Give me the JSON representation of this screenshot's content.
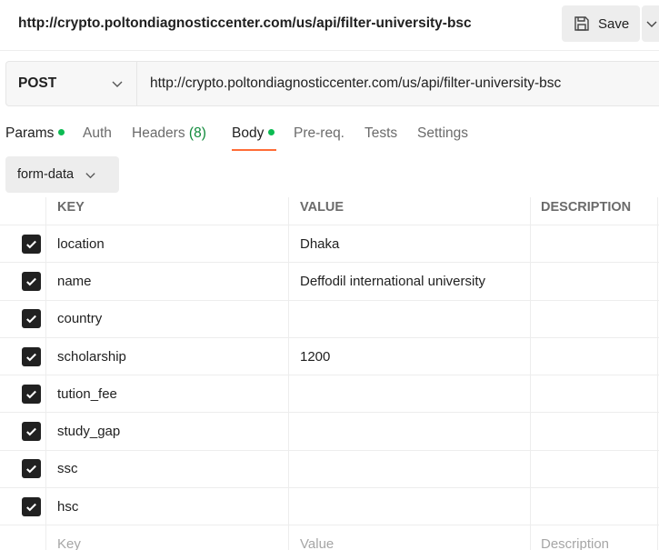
{
  "header": {
    "title": "http://crypto.poltondiagnosticcenter.com/us/api/filter-university-bsc",
    "save_label": "Save"
  },
  "request": {
    "method": "POST",
    "url": "http://crypto.poltondiagnosticcenter.com/us/api/filter-university-bsc"
  },
  "tabs": {
    "params": "Params",
    "auth": "Auth",
    "headers": "Headers",
    "headers_count": "(8)",
    "body": "Body",
    "prereq": "Pre-req.",
    "tests": "Tests",
    "settings": "Settings"
  },
  "body_type": "form-data",
  "table": {
    "columns": {
      "key": "KEY",
      "value": "VALUE",
      "description": "DESCRIPTION"
    },
    "rows": [
      {
        "key": "location",
        "value": "Dhaka",
        "description": "",
        "checked": true
      },
      {
        "key": "name",
        "value": "Deffodil international university",
        "description": "",
        "checked": true
      },
      {
        "key": "country",
        "value": "",
        "description": "",
        "checked": true
      },
      {
        "key": "scholarship",
        "value": "1200",
        "description": "",
        "checked": true
      },
      {
        "key": "tution_fee",
        "value": "",
        "description": "",
        "checked": true
      },
      {
        "key": "study_gap",
        "value": "",
        "description": "",
        "checked": true
      },
      {
        "key": "ssc",
        "value": "",
        "description": "",
        "checked": true
      },
      {
        "key": "hsc",
        "value": "",
        "description": "",
        "checked": true
      }
    ],
    "placeholders": {
      "key": "Key",
      "value": "Value",
      "description": "Description"
    }
  },
  "colors": {
    "accent_underline": "#ff6c37",
    "active_dot": "#0cbb52",
    "checkbox": "#212121"
  }
}
